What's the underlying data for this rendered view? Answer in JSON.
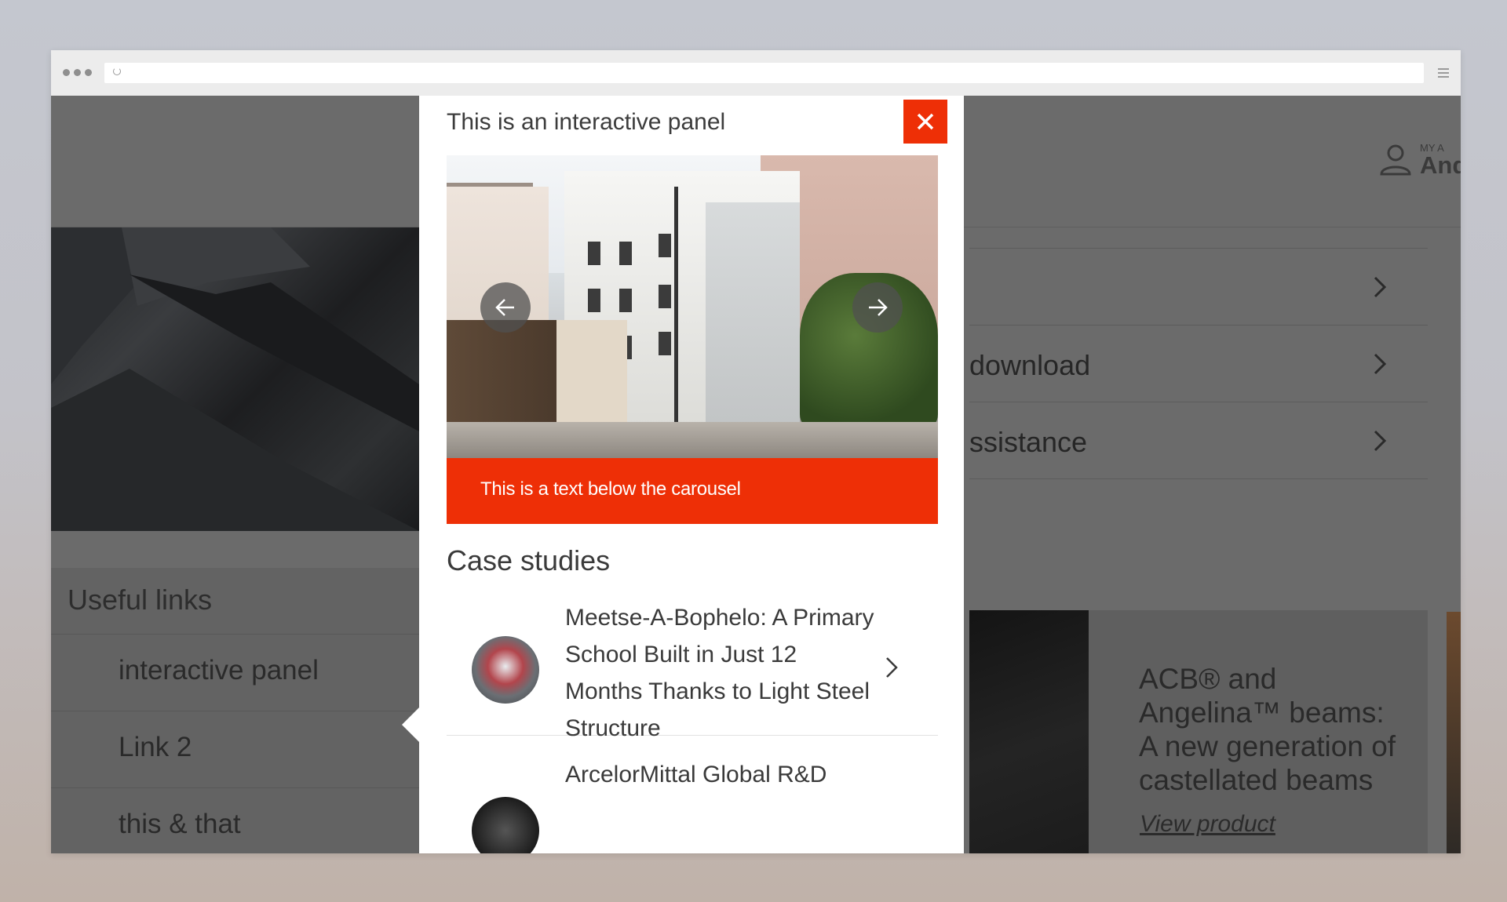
{
  "background": {
    "window": "#6b6b6b",
    "accent": "#ee2f06"
  },
  "browser": {
    "url": ""
  },
  "account": {
    "label_small": "MY A",
    "name": "And",
    "icon": "user-icon"
  },
  "sidebar": {
    "title": "Useful links",
    "links": [
      {
        "label": "interactive panel"
      },
      {
        "label": "Link 2"
      },
      {
        "label": "this & that"
      }
    ]
  },
  "right_menu": {
    "items": [
      {
        "label": ""
      },
      {
        "label": "download"
      },
      {
        "label": "ssistance"
      }
    ]
  },
  "feature": {
    "title": "ACB® and Angelina™ beams: A new generation of castellated beams",
    "link": "View product"
  },
  "panel": {
    "title": "This is an interactive panel",
    "close_icon": "close-icon",
    "carousel": {
      "prev_icon": "arrow-left-icon",
      "next_icon": "arrow-right-icon",
      "caption": "This is a text below the carousel"
    },
    "case_studies": {
      "heading": "Case studies",
      "items": [
        {
          "title": "Meetse-A-Bophelo: A Primary School Built in Just 12 Months Thanks to Light Steel Structure"
        },
        {
          "title": "ArcelorMittal Global R&D"
        }
      ]
    }
  }
}
